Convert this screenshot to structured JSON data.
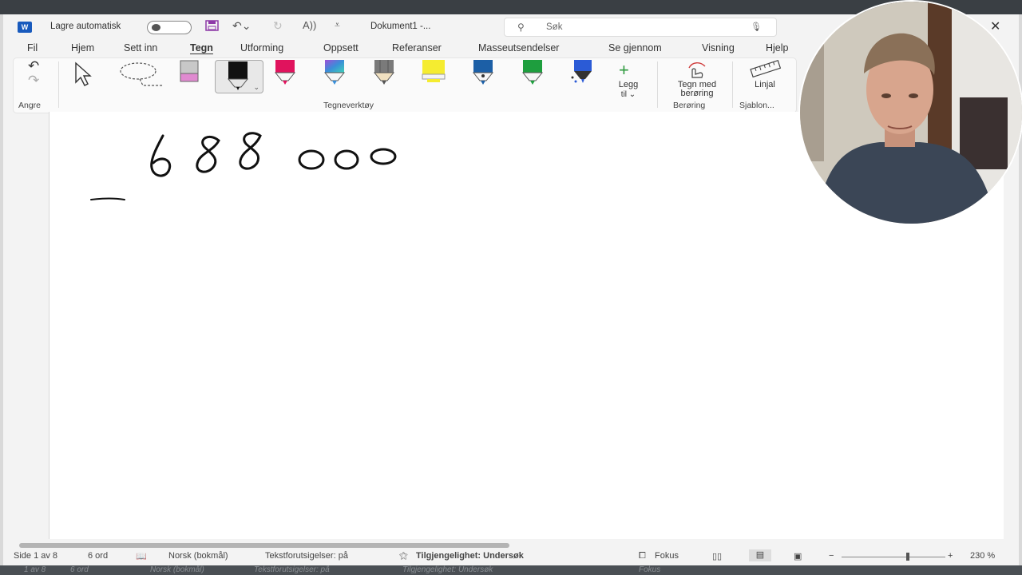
{
  "app": {
    "autosave_label": "Lagre automatisk",
    "doc_title": "Dokument1  -...",
    "search_placeholder": "Søk"
  },
  "menu": [
    "Fil",
    "Hjem",
    "Sett inn",
    "Tegn",
    "Utforming",
    "Oppsett",
    "Referanser",
    "Masseutsendelser",
    "Se gjennom",
    "Visning",
    "Hjelp"
  ],
  "active_menu": "Tegn",
  "ribbon": {
    "undo_group_label": "Angre",
    "tools_group_label": "Tegneverktøy",
    "add_pen_label": "Legg",
    "add_pen_label2": "til",
    "touch_label": "Tegn med",
    "touch_label2": "berøring",
    "touch_group_label": "Berøring",
    "ruler_label": "Linjal",
    "stencil_group_label": "Sjablon..."
  },
  "pen_colors": [
    "#e0135d",
    "#3a8fd8",
    "#7a7a7a",
    "#f5ec30",
    "#1c5fa6",
    "#1e9e3e",
    "#2b5bd6"
  ],
  "ink": {
    "number_text": "688 000"
  },
  "status": {
    "page": "Side 1 av 8",
    "words": "6 ord",
    "language": "Norsk (bokmål)",
    "predictions": "Tekstforutsigelser: på",
    "accessibility": "Tilgjengelighet: Undersøk",
    "focus": "Fokus",
    "zoom": "230 %"
  },
  "ghost_line": {
    "a": "1 av 8",
    "b": "6 ord",
    "c": "Norsk (bokmål)",
    "d": "Tekstforutsigelser: på",
    "e": "Tilgjengelighet: Undersøk",
    "f": "Fokus"
  },
  "colors": {
    "accent": "#185abd",
    "ribbon_bg": "#fafafa",
    "window_bg": "#f3f3f3"
  }
}
